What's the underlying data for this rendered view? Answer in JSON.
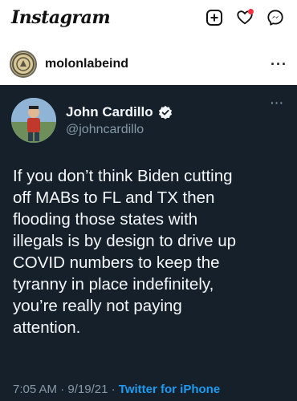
{
  "app": {
    "name": "Instagram",
    "icons": [
      "new-post-icon",
      "activity-heart-icon",
      "messenger-icon"
    ],
    "notification_color": "#ff3040"
  },
  "post": {
    "username": "molonlabeind",
    "more_label": "···"
  },
  "tweet": {
    "display_name": "John Cardillo",
    "handle": "@johncardillo",
    "verified": true,
    "more_label": "···",
    "text": "If you don’t think Biden cutting\noff MABs to FL and TX then\nflooding those states with\nillegals is by design to drive up\nCOVID numbers to keep the\ntyranny in place indefinitely,\nyou’re really not paying\nattention.",
    "time": "7:05 AM",
    "date": "9/19/21",
    "separator": "·",
    "source": "Twitter for iPhone",
    "background_color": "#15202b",
    "link_color": "#1d9bf0"
  }
}
